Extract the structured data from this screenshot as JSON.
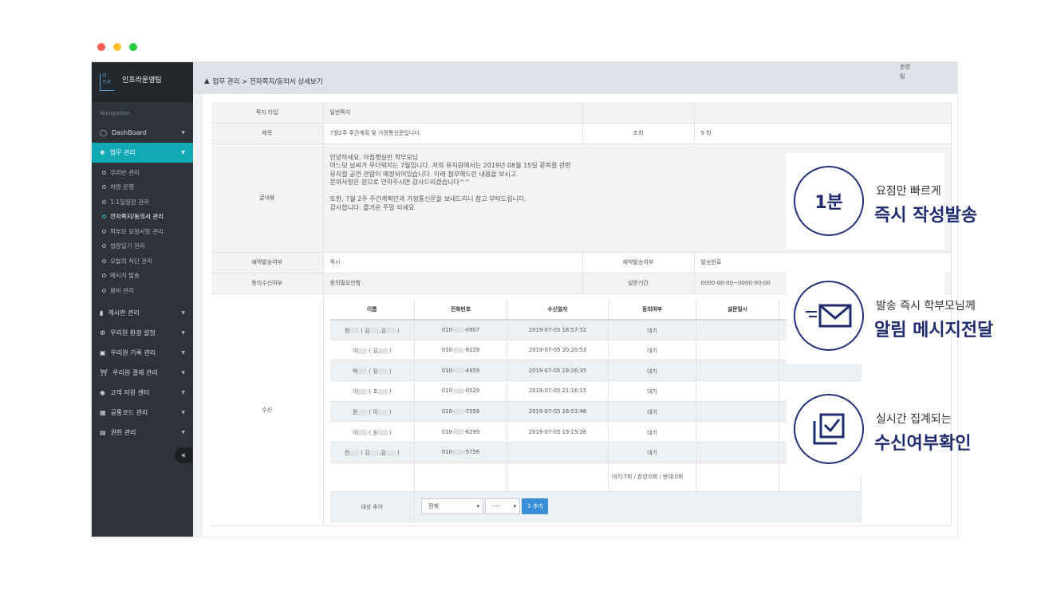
{
  "window": {
    "dot_colors": [
      "#ff5f57",
      "#ffbd2e",
      "#28c940"
    ]
  },
  "sidebar": {
    "brand_logo": "리\n프라",
    "brand_name": "인프라운영팀",
    "nav_caption": "Navigation",
    "dashboard": "DashBoard",
    "work": "업무 관리",
    "sub_items": [
      "우리반 관리",
      "차량 운행",
      "1:1일림장 관리",
      "전자쪽지/동의서 관리",
      "학부모 요청사항 관리",
      "성장일기 관리",
      "오늘의 식단 관리",
      "메시지 발송",
      "원비 관리"
    ],
    "menus": [
      "게시판 관리",
      "우리원 환경 설정",
      "우리원 기록 관리",
      "우리원 결제 관리",
      "고객 지원 센터",
      "공통코드 관리",
      "권한 관리"
    ],
    "collapse": "«"
  },
  "topbar": {
    "breadcrumb": "업무 관리 > 전자쪽지/동의서 상세보기",
    "user": "운영팀"
  },
  "detail": {
    "type_label": "쪽지 타입",
    "type_value": "일반쪽지",
    "title_label": "제목",
    "title_value": "7월2주 주간계획 및 가정통신문입니다.",
    "views_label": "조회",
    "views_value": "9 회",
    "body_label": "글내용",
    "body_lines": [
      "안녕하세요.  아침햇살반 학부모님",
      "어느덧 날씨가 무더워지는 7월입니다. 저희 유치원에서는 2019년 08월 15일 광복절 관련",
      "뮤지컬 공연 관람이 예정되어있습니다. 아래 첨부해드린 내용을 보시고",
      "문의사항은 원으로 연락주시면 감사드리겠습니다^^",
      "",
      "또한, 7월 2주 주간계획안과 가정통신문을 보내드리니 참고 부탁드립니다.",
      "감사합니다. 즐거운 주말 되세요"
    ],
    "reserve_label": "예약발송여부",
    "reserve_value": "즉시",
    "reserve_label2": "예약발송여부",
    "reserve_value2": "발송완료",
    "consent_label": "동의수신여부",
    "consent_value": "동의필요안함",
    "survey_label": "설문기간",
    "survey_value": "0000-00-00~0000-00-00",
    "recv_label": "수신"
  },
  "recipients": {
    "headers": [
      "이름",
      "전화번호",
      "수신일자",
      "동의여부",
      "설문일시"
    ],
    "rows": [
      {
        "name": "정",
        "name_mid": " ( 김",
        "name_end": ",김",
        "phone_a": "010-",
        "phone_b": "-0907",
        "date": "2019-07-05 18:57:52",
        "status": "대기"
      },
      {
        "name": "이",
        "name_mid": " ( 김",
        "name_end": " )",
        "phone_a": "010-",
        "phone_b": "-8129",
        "date": "2019-07-05 20:20:53",
        "status": "대기"
      },
      {
        "name": "박",
        "name_mid": " ( 장",
        "name_end": " )",
        "phone_a": "010-",
        "phone_b": "-4959",
        "date": "2019-07-05 19:26:35",
        "status": "대기"
      },
      {
        "name": "이",
        "name_mid": " ( 조",
        "name_end": " )",
        "phone_a": "010-",
        "phone_b": "-0529",
        "date": "2019-07-05 21:16:15",
        "status": "대기"
      },
      {
        "name": "윤",
        "name_mid": " ( 이",
        "name_end": " )",
        "phone_a": "010-",
        "phone_b": "-7558",
        "date": "2019-07-05 18:53:48",
        "status": "대기"
      },
      {
        "name": "이",
        "name_mid": " ( 윤",
        "name_end": " )",
        "phone_a": "010-",
        "phone_b": "-6299",
        "date": "2019-07-05 19:15:26",
        "status": "대기"
      },
      {
        "name": "전",
        "name_mid": " ( 김",
        "name_end": ",김",
        "phone_a": "010-",
        "phone_b": "-5758",
        "date": "",
        "status": "대기"
      }
    ],
    "summary": "대기:7회 / 찬성:0회 / 반대:0회",
    "add_label": "대상 추가",
    "select_all": "전체",
    "select_dash": "----",
    "add_button": "추가"
  },
  "features": [
    {
      "icon": "1분",
      "sub": "요점만 빠르게",
      "main": "즉시 작성발송"
    },
    {
      "icon": "envelope-icon",
      "sub": "발송 즉시 학부모님께",
      "main": "알림 메시지전달"
    },
    {
      "icon": "checklist-icon",
      "sub": "실시간 집계되는",
      "main": "수신여부확인"
    }
  ]
}
